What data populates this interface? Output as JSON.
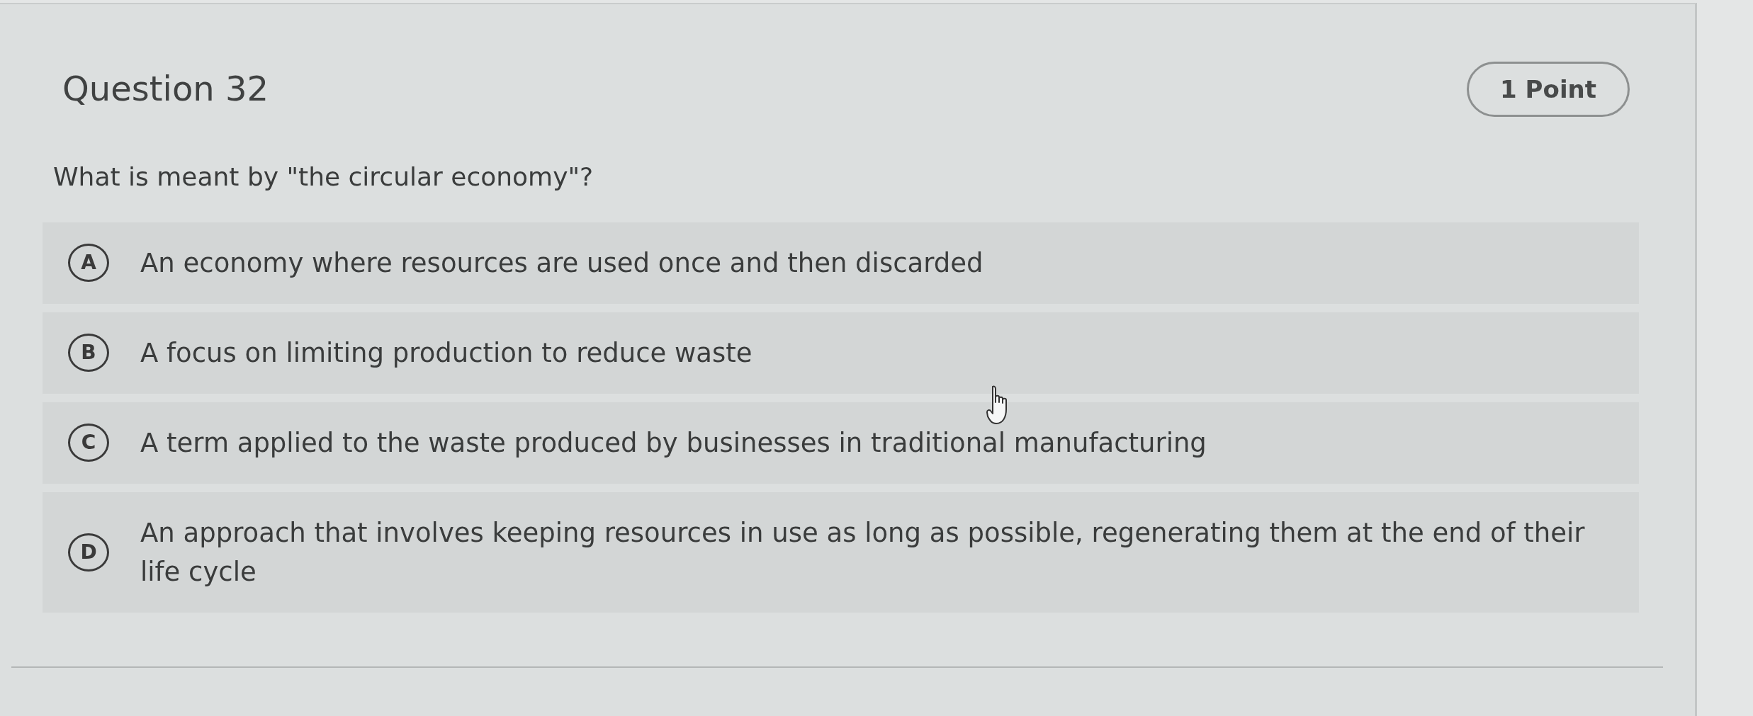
{
  "question": {
    "title": "Question 32",
    "points": "1 Point",
    "prompt": "What is meant by \"the circular economy\"?"
  },
  "options": [
    {
      "letter": "A",
      "text": "An economy where resources are used once and then discarded",
      "selected": false
    },
    {
      "letter": "B",
      "text": "A focus on limiting production to reduce waste",
      "selected": false
    },
    {
      "letter": "C",
      "text": "A term applied to the waste produced by businesses in traditional manufacturing",
      "selected": false
    },
    {
      "letter": "D",
      "text": "An approach that involves keeping resources in use as long as possible, regenerating them at the end of their life cycle",
      "selected": false
    }
  ]
}
